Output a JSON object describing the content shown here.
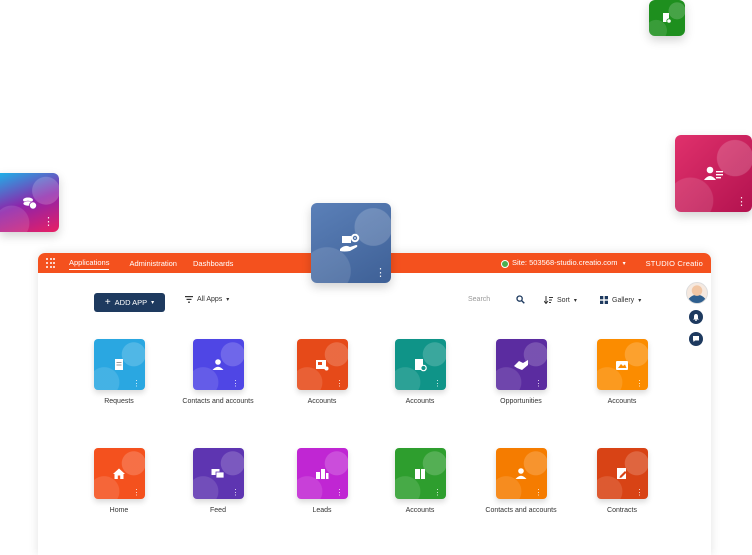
{
  "colors": {
    "topbar": "#f4511e",
    "add_app_button": "#1e3a5f",
    "float_green": "#1e8f1e",
    "float_pink": "#c2185b",
    "float_purple": "#7b1fa2",
    "float_blue": "#4a6fa5"
  },
  "floating_tiles": [
    {
      "icon": "document-icon"
    },
    {
      "icon": "contact-card-icon"
    },
    {
      "icon": "coins-icon"
    },
    {
      "icon": "hand-gear-icon"
    }
  ],
  "topbar": {
    "tabs": [
      {
        "label": "Applications",
        "active": true
      },
      {
        "label": "Administration",
        "active": false
      },
      {
        "label": "Dashboards",
        "active": false
      }
    ],
    "site": "Site: 503568-studio.creatio.com",
    "logo": "STUDIO Creatio"
  },
  "toolbar": {
    "add_app": "ADD APP",
    "filter": "All Apps",
    "search_placeholder": "Search",
    "sort": "Sort",
    "view": "Gallery"
  },
  "apps": [
    {
      "label": "Requests",
      "color": "#2aa7e1",
      "icon": "document-icon"
    },
    {
      "label": "Contacts and accounts",
      "color": "#4f46e5",
      "icon": "person-icon"
    },
    {
      "label": "Accounts",
      "color": "#e64a19",
      "icon": "gallery-icon"
    },
    {
      "label": "Accounts",
      "color": "#0f9488",
      "icon": "document-settings-icon"
    },
    {
      "label": "Opportunities",
      "color": "#5b2ca0",
      "icon": "handshake-icon"
    },
    {
      "label": "Accounts",
      "color": "#fb8c00",
      "icon": "folder-image-icon"
    },
    {
      "label": "Home",
      "color": "#f4511e",
      "icon": "home-icon"
    },
    {
      "label": "Feed",
      "color": "#5e35b1",
      "icon": "chat-icon"
    },
    {
      "label": "Leads",
      "color": "#c026d3",
      "icon": "buildings-icon"
    },
    {
      "label": "Accounts",
      "color": "#2e9e2e",
      "icon": "ledger-icon"
    },
    {
      "label": "Contacts and accounts",
      "color": "#f57c00",
      "icon": "person-icon"
    },
    {
      "label": "Contracts",
      "color": "#d84315",
      "icon": "contract-pen-icon"
    }
  ]
}
